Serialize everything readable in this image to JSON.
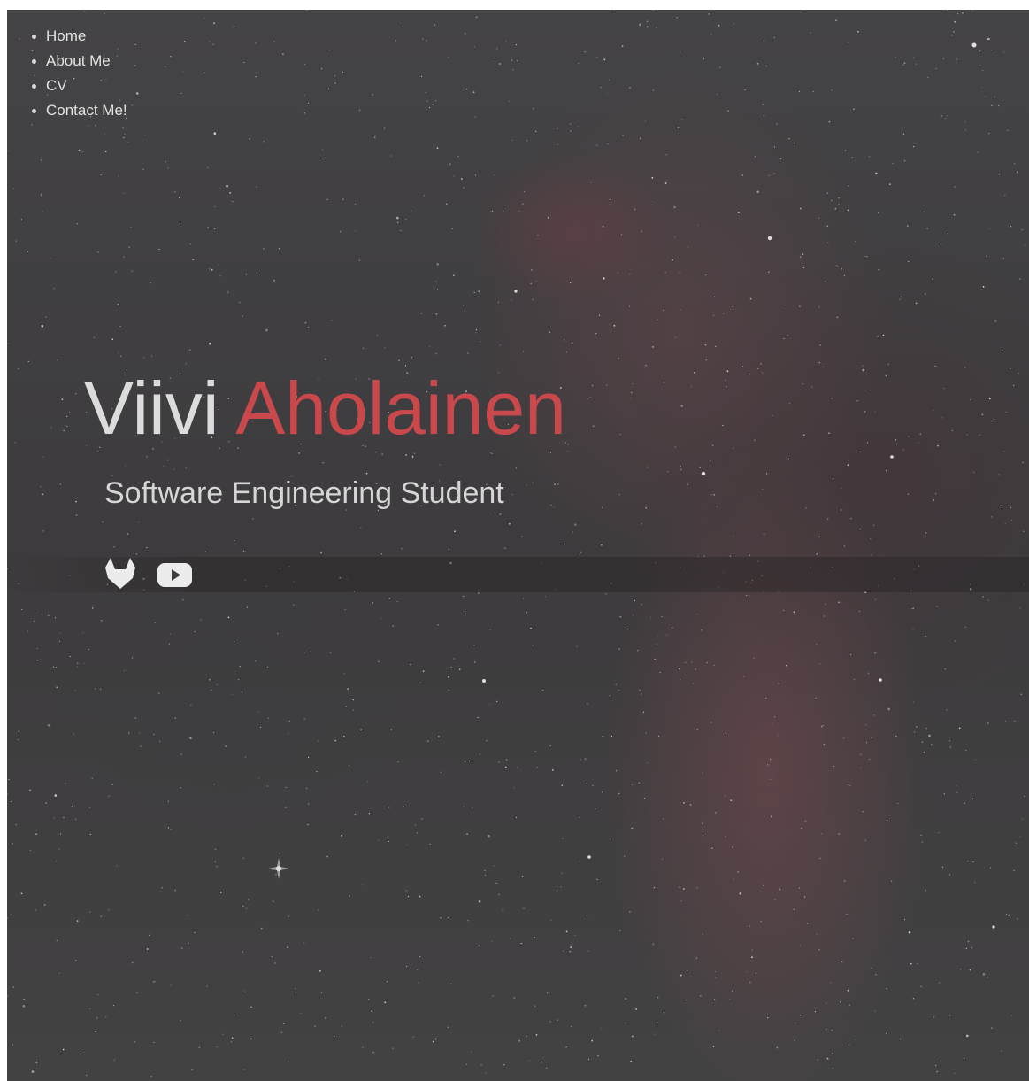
{
  "nav": {
    "items": [
      {
        "label": "Home"
      },
      {
        "label": "About Me"
      },
      {
        "label": "CV"
      },
      {
        "label": "Contact Me!"
      }
    ]
  },
  "hero": {
    "first_name": "Viivi",
    "last_name": "Aholainen",
    "subtitle": "Software Engineering Student"
  },
  "social": {
    "icons": [
      "gitlab-icon",
      "youtube-icon"
    ]
  },
  "colors": {
    "accent": "#c9484c",
    "text_light": "#dcdcdc",
    "background": "#403e40"
  }
}
